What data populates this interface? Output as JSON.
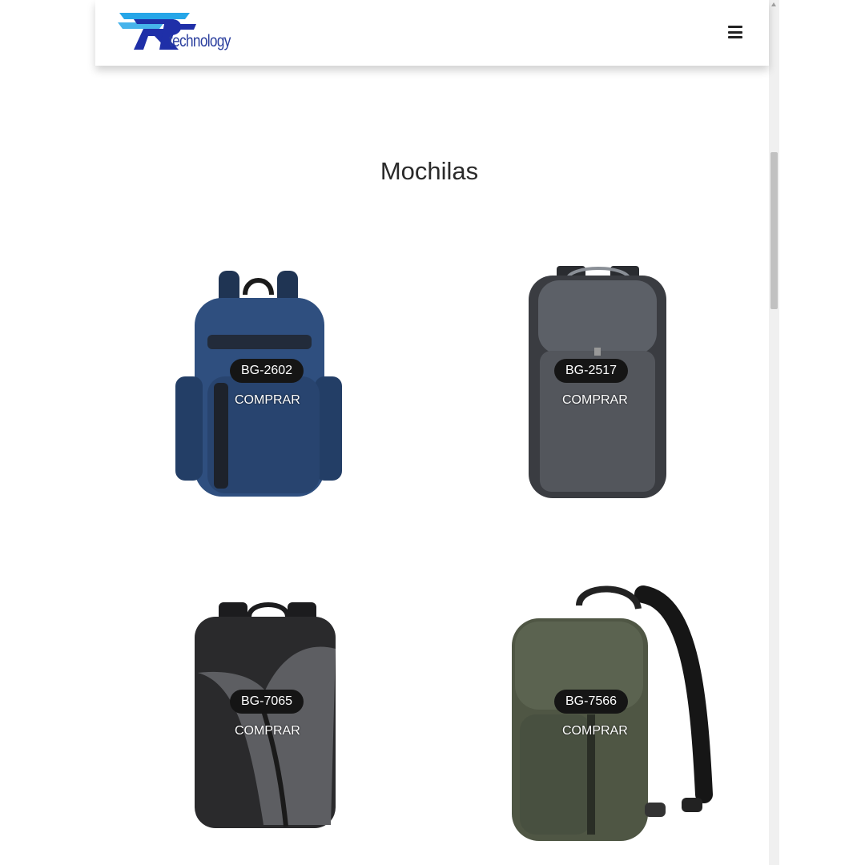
{
  "brand": {
    "logo_letters": "RF",
    "logo_text": "technology",
    "colors": {
      "primary": "#1f2fa8",
      "accent": "#26a6e8"
    }
  },
  "header": {
    "menu_icon": "hamburger-menu-icon"
  },
  "main": {
    "title": "Mochilas"
  },
  "products": [
    {
      "model": "BG-2602",
      "buy_label": "COMPRAR",
      "color": "#2f4f7f"
    },
    {
      "model": "BG-2517",
      "buy_label": "COMPRAR",
      "color": "#55585e"
    },
    {
      "model": "BG-7065",
      "buy_label": "COMPRAR",
      "color": "#2a2a2c"
    },
    {
      "model": "BG-7566",
      "buy_label": "COMPRAR",
      "color": "#4f5644"
    }
  ]
}
